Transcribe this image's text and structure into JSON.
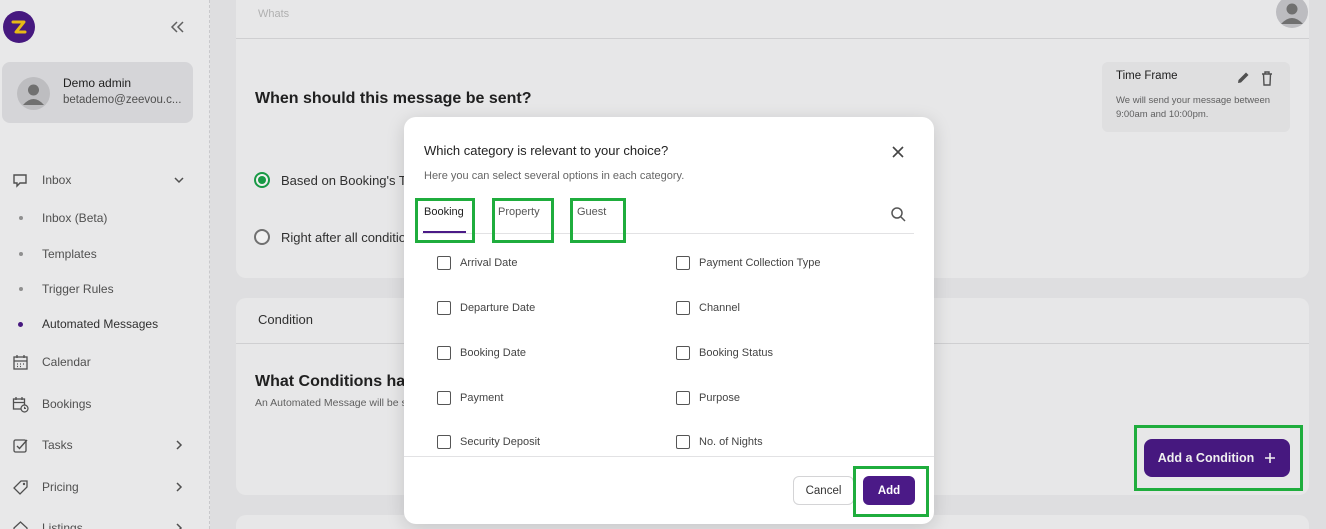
{
  "colors": {
    "brand": "#4b1a87",
    "radio_selected": "#1aa34a",
    "highlight": "#1fad3d"
  },
  "sidebar": {
    "collapse_icon": "double-chevron-left-icon",
    "user": {
      "name": "Demo admin",
      "email": "betademo@zeevou.c..."
    },
    "nav": [
      {
        "label": "Inbox",
        "icon": "message-icon",
        "expanded": true
      },
      {
        "label": "Inbox (Beta)",
        "sub": true
      },
      {
        "label": "Templates",
        "sub": true
      },
      {
        "label": "Trigger Rules",
        "sub": true
      },
      {
        "label": "Automated Messages",
        "sub": true,
        "active": true
      },
      {
        "label": "Calendar",
        "icon": "calendar-icon"
      },
      {
        "label": "Bookings",
        "icon": "calendar-clock-icon"
      },
      {
        "label": "Tasks",
        "icon": "task-icon"
      },
      {
        "label": "Pricing",
        "icon": "tag-icon"
      },
      {
        "label": "Listings",
        "icon": "home-icon"
      }
    ]
  },
  "main": {
    "header_text": "Whats",
    "send_section": {
      "title": "When should this message be sent?",
      "option1": "Based on Booking's Timeline",
      "option2": "Right after all conditions are met"
    },
    "time_frame": {
      "title": "Time Frame",
      "description": "We will send your message between 9:00am and 10:00pm."
    },
    "condition_section": {
      "header": "Condition",
      "title": "What Conditions have to be met?",
      "subtitle": "An Automated Message will be sent when all conditions are met.",
      "add_button": "Add a Condition"
    }
  },
  "modal": {
    "title": "Which category is relevant to your choice?",
    "subtitle": "Here you can select several options in each category.",
    "tabs": [
      "Booking",
      "Property",
      "Guest"
    ],
    "options_left": [
      "Arrival Date",
      "Departure Date",
      "Booking Date",
      "Payment",
      "Security Deposit"
    ],
    "options_right": [
      "Payment Collection Type",
      "Channel",
      "Booking Status",
      "Purpose",
      "No. of Nights"
    ],
    "cancel_label": "Cancel",
    "add_label": "Add"
  }
}
